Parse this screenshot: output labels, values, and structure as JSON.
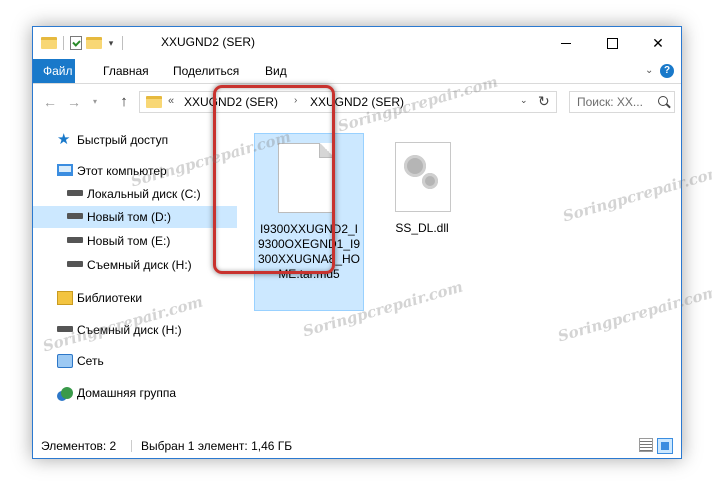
{
  "window": {
    "title": "XXUGND2 (SER)"
  },
  "ribbon": {
    "tabs": [
      {
        "label": "Файл"
      },
      {
        "label": "Главная"
      },
      {
        "label": "Поделиться"
      },
      {
        "label": "Вид"
      }
    ],
    "help_label": "?"
  },
  "address": {
    "overflow": "«",
    "crumbs": [
      "XXUGND2 (SER)",
      "XXUGND2 (SER)"
    ],
    "separator": "›"
  },
  "search": {
    "placeholder": "Поиск: XX..."
  },
  "sidebar": {
    "items": [
      {
        "label": "Быстрый доступ",
        "icon": "star-icon"
      },
      {
        "label": "Этот компьютер",
        "icon": "computer-icon"
      },
      {
        "label": "Локальный диск (C:)",
        "icon": "drive-icon"
      },
      {
        "label": "Новый том (D:)",
        "icon": "drive-icon",
        "selected": true
      },
      {
        "label": "Новый том (E:)",
        "icon": "drive-icon"
      },
      {
        "label": "Съемный диск (H:)",
        "icon": "drive-icon"
      },
      {
        "label": "Библиотеки",
        "icon": "library-icon"
      },
      {
        "label": "Съемный диск (H:)",
        "icon": "drive-icon"
      },
      {
        "label": "Сеть",
        "icon": "network-icon"
      },
      {
        "label": "Домашняя группа",
        "icon": "homegroup-icon"
      }
    ]
  },
  "files": [
    {
      "name": "I9300XXUGND2_I9300OXEGND1_I9300XXUGNA8_HOME.tar.md5",
      "icon": "document-icon",
      "selected": true
    },
    {
      "name": "SS_DL.dll",
      "icon": "dll-gear-icon",
      "selected": false
    }
  ],
  "status": {
    "count": "Элементов: 2",
    "selection": "Выбран 1 элемент: 1,46 ГБ"
  },
  "watermark": {
    "text": "Soringpcrepair.com"
  },
  "colors": {
    "accent": "#1979ca",
    "selection": "#cce8ff",
    "highlight_frame": "#c8322e"
  }
}
